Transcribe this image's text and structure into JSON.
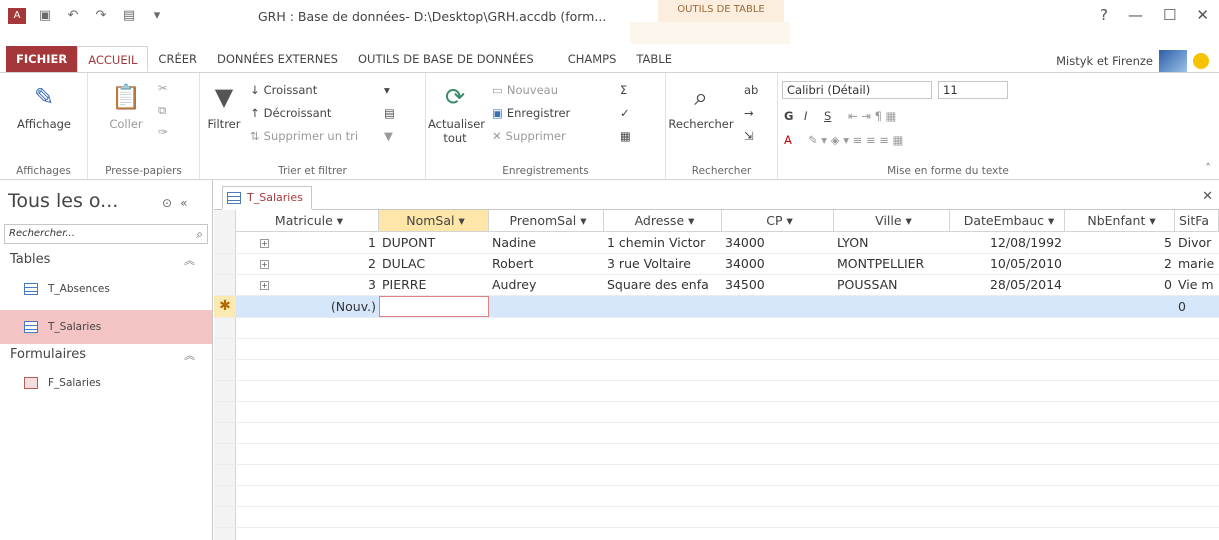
{
  "window": {
    "title": "GRH : Base de données- D:\\Desktop\\GRH.accdb (form...",
    "context_title": "OUTILS DE TABLE",
    "controls": [
      "?",
      "—",
      "☐",
      "✕"
    ]
  },
  "tabs": [
    "FICHIER",
    "ACCUEIL",
    "CRÉER",
    "DONNÉES EXTERNES",
    "OUTILS DE BASE DE DONNÉES",
    "CHAMPS",
    "TABLE"
  ],
  "user": {
    "name": "Mistyk et Firenze"
  },
  "ribbon": {
    "affichages": {
      "label": "Affichages",
      "btn": "Affichage"
    },
    "presse": {
      "label": "Presse-papiers",
      "btn": "Coller"
    },
    "trier": {
      "label": "Trier et filtrer",
      "filtrer": "Filtrer",
      "croissant": "Croissant",
      "decroissant": "Décroissant",
      "supprimer_tri": "Supprimer un tri"
    },
    "enreg": {
      "label": "Enregistrements",
      "actualiser": "Actualiser",
      "tout": "tout",
      "nouveau": "Nouveau",
      "enregistrer": "Enregistrer",
      "supprimer": "Supprimer"
    },
    "rechercher": {
      "label": "Rechercher",
      "btn": "Rechercher"
    },
    "mise": {
      "label": "Mise en forme du texte",
      "font": "Calibri (Détail)",
      "size": "11",
      "g": "G",
      "i": "I",
      "s": "S"
    }
  },
  "nav": {
    "title": "Tous les o...",
    "search": "Rechercher...",
    "sections": [
      {
        "label": "Tables",
        "items": [
          "T_Absences",
          "T_Salaries"
        ]
      },
      {
        "label": "Formulaires",
        "items": [
          "F_Salaries"
        ]
      }
    ]
  },
  "doc": {
    "tab": "T_Salaries"
  },
  "table": {
    "columns": [
      "Matricule",
      "NomSal",
      "PrenomSal",
      "Adresse",
      "CP",
      "Ville",
      "DateEmbauc",
      "NbEnfant",
      "SitFa"
    ],
    "rows": [
      [
        "1",
        "DUPONT",
        "Nadine",
        "1 chemin Victor",
        "34000",
        "LYON",
        "12/08/1992",
        "5",
        "Divor"
      ],
      [
        "2",
        "DULAC",
        "Robert",
        "3 rue Voltaire",
        "34000",
        "MONTPELLIER",
        "10/05/2010",
        "2",
        "marie"
      ],
      [
        "3",
        "PIERRE",
        "Audrey",
        "Square des enfa",
        "34500",
        "POUSSAN",
        "28/05/2014",
        "0",
        "Vie m"
      ]
    ],
    "new_label": "(Nouv.)",
    "new_nb": "0"
  }
}
